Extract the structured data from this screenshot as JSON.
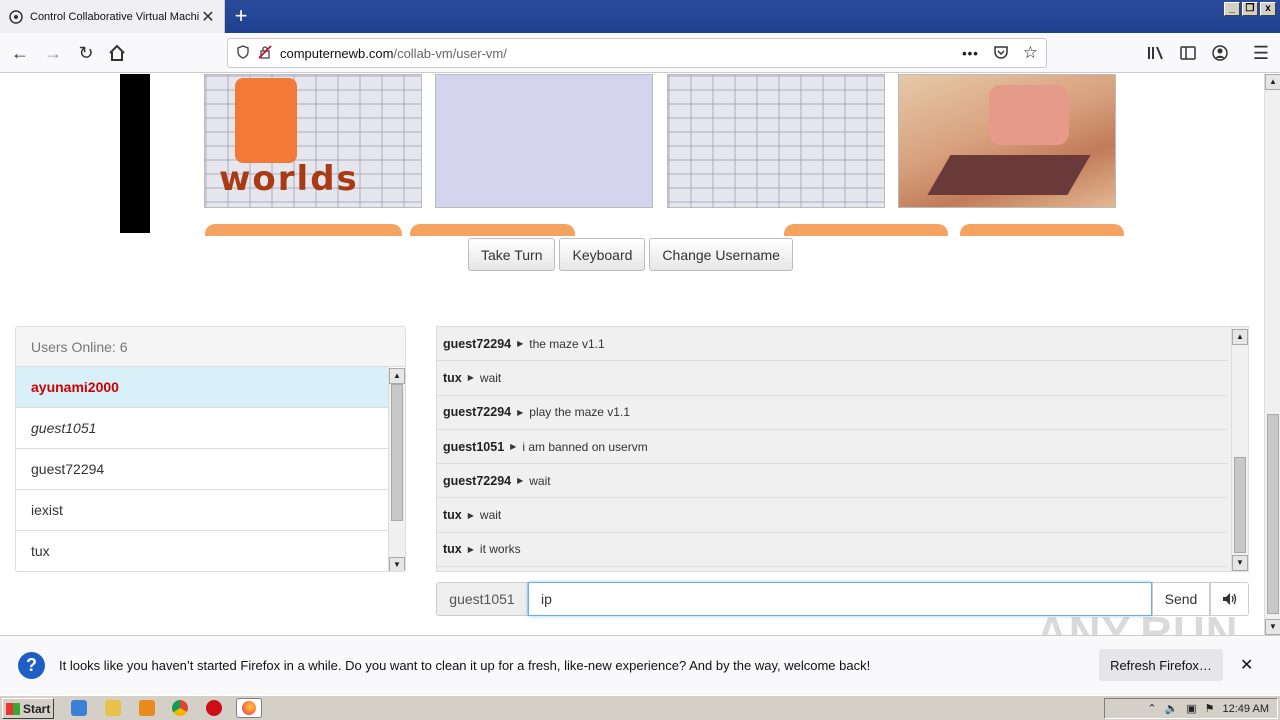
{
  "browser": {
    "tab_title": "Control Collaborative Virtual Machi",
    "url_host": "computernewb.com",
    "url_path": "/collab-vm/user-vm/"
  },
  "vm": {
    "logo_text": "worlds",
    "buttons": [
      "Take Turn",
      "Keyboard",
      "Change Username"
    ]
  },
  "users": {
    "header": "Users Online: 6",
    "list": [
      {
        "name": "ayunami2000",
        "style": "self"
      },
      {
        "name": "guest1051",
        "style": "italic"
      },
      {
        "name": "guest72294",
        "style": "normal"
      },
      {
        "name": "iexist",
        "style": "normal"
      },
      {
        "name": "tux",
        "style": "normal"
      }
    ]
  },
  "chat": {
    "messages": [
      {
        "user": "guest72294",
        "text": "the maze v1.1"
      },
      {
        "user": "tux",
        "text": "wait"
      },
      {
        "user": "guest72294",
        "text": "play the maze v1.1"
      },
      {
        "user": "guest1051",
        "text": "i am banned on uservm"
      },
      {
        "user": "guest72294",
        "text": "wait"
      },
      {
        "user": "tux",
        "text": "wait"
      },
      {
        "user": "tux",
        "text": "it works"
      }
    ],
    "username": "guest1051",
    "input_value": "ip",
    "send_label": "Send"
  },
  "notification": {
    "text": "It looks like you haven’t started Firefox in a while. Do you want to clean it up for a fresh, like-new experience? And by the way, welcome back!",
    "button": "Refresh Firefox…"
  },
  "watermark": "ANY.RUN",
  "taskbar": {
    "start": "Start",
    "clock": "12:49 AM"
  }
}
